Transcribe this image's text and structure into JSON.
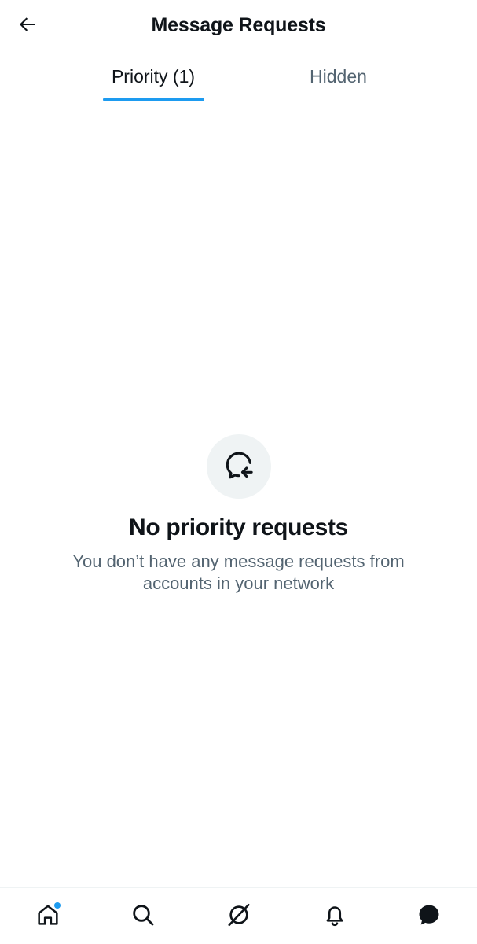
{
  "header": {
    "title": "Message Requests",
    "back_icon": "arrow-left-icon"
  },
  "tabs": [
    {
      "label": "Priority (1)",
      "active": true
    },
    {
      "label": "Hidden",
      "active": false
    }
  ],
  "empty_state": {
    "icon": "message-incoming-icon",
    "title": "No priority requests",
    "description": "You don’t have any message requests from accounts in your network"
  },
  "bottom_nav": {
    "items": [
      {
        "name": "home",
        "icon": "home-icon",
        "has_badge": true
      },
      {
        "name": "search",
        "icon": "search-icon"
      },
      {
        "name": "spaces",
        "icon": "spaces-icon"
      },
      {
        "name": "notifications",
        "icon": "bell-icon"
      },
      {
        "name": "messages",
        "icon": "message-bubble-icon",
        "active": true
      }
    ]
  },
  "colors": {
    "accent": "#1d9bf0",
    "text_primary": "#0f1419",
    "text_secondary": "#536471",
    "icon_bg": "#eff3f4"
  }
}
